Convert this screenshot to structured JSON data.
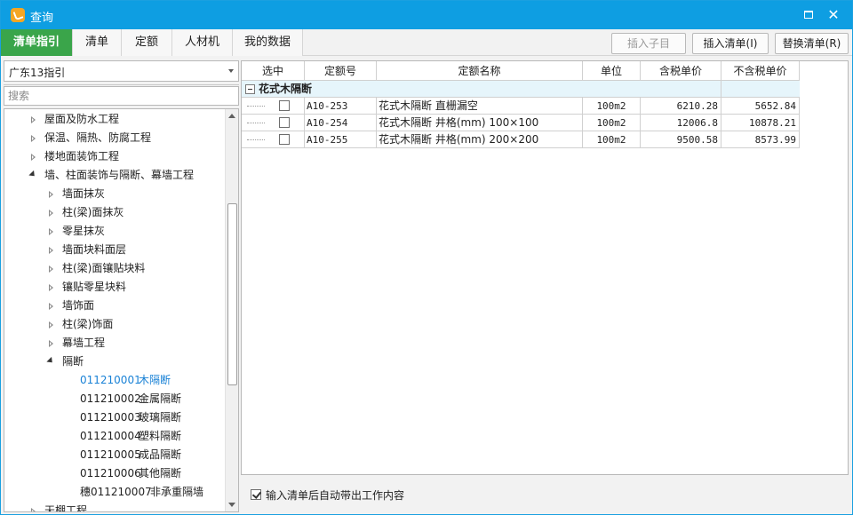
{
  "window": {
    "title": "查询",
    "accent": "#0e9ee2",
    "active_tab_color": "#3aa54a",
    "selected_color": "#1a82d6"
  },
  "tabs": [
    {
      "label": "清单指引",
      "active": true
    },
    {
      "label": "清单"
    },
    {
      "label": "定额"
    },
    {
      "label": "人材机"
    },
    {
      "label": "我的数据"
    }
  ],
  "toolbar": {
    "insert_child": "插入子目",
    "insert_list": "插入清单(I)",
    "replace_list": "替换清单(R)"
  },
  "left": {
    "combo_value": "广东13指引",
    "search_placeholder": "搜索",
    "tree": [
      {
        "label": "屋面及防水工程",
        "level": 1,
        "state": "collapsed"
      },
      {
        "label": "保温、隔热、防腐工程",
        "level": 1,
        "state": "collapsed"
      },
      {
        "label": "楼地面装饰工程",
        "level": 1,
        "state": "collapsed"
      },
      {
        "label": "墙、柱面装饰与隔断、幕墙工程",
        "level": 1,
        "state": "expanded"
      },
      {
        "label": "墙面抹灰",
        "level": 2,
        "state": "collapsed"
      },
      {
        "label": "柱(梁)面抹灰",
        "level": 2,
        "state": "collapsed"
      },
      {
        "label": "零星抹灰",
        "level": 2,
        "state": "collapsed"
      },
      {
        "label": "墙面块料面层",
        "level": 2,
        "state": "collapsed"
      },
      {
        "label": "柱(梁)面镶贴块料",
        "level": 2,
        "state": "collapsed"
      },
      {
        "label": "镶贴零星块料",
        "level": 2,
        "state": "collapsed"
      },
      {
        "label": "墙饰面",
        "level": 2,
        "state": "collapsed"
      },
      {
        "label": "柱(梁)饰面",
        "level": 2,
        "state": "collapsed"
      },
      {
        "label": "幕墙工程",
        "level": 2,
        "state": "collapsed"
      },
      {
        "label": "隔断",
        "level": 2,
        "state": "expanded"
      }
    ],
    "leaves": [
      {
        "code": "011210001",
        "name": "木隔断",
        "selected": true
      },
      {
        "code": "011210002",
        "name": "金属隔断"
      },
      {
        "code": "011210003",
        "name": "玻璃隔断"
      },
      {
        "code": "011210004",
        "name": "塑料隔断"
      },
      {
        "code": "011210005",
        "name": "成品隔断"
      },
      {
        "code": "011210006",
        "name": "其他隔断"
      },
      {
        "code": "穗011210007",
        "name": "非承重隔墙"
      }
    ],
    "cutoff_item": "天棚工程"
  },
  "grid": {
    "headers": [
      "选中",
      "定额号",
      "定额名称",
      "单位",
      "含税单价",
      "不含税单价"
    ],
    "group_label": "花式木隔断",
    "rows": [
      {
        "code": "A10-253",
        "name": "花式木隔断 直栅漏空",
        "unit": "100m2",
        "price_tax": "6210.28",
        "price_notax": "5652.84"
      },
      {
        "code": "A10-254",
        "name": "花式木隔断 井格(mm) 100×100",
        "unit": "100m2",
        "price_tax": "12006.8",
        "price_notax": "10878.21"
      },
      {
        "code": "A10-255",
        "name": "花式木隔断 井格(mm) 200×200",
        "unit": "100m2",
        "price_tax": "9500.58",
        "price_notax": "8573.99"
      }
    ]
  },
  "bottom": {
    "auto_content_label": "输入清单后自动带出工作内容",
    "checked": true
  }
}
